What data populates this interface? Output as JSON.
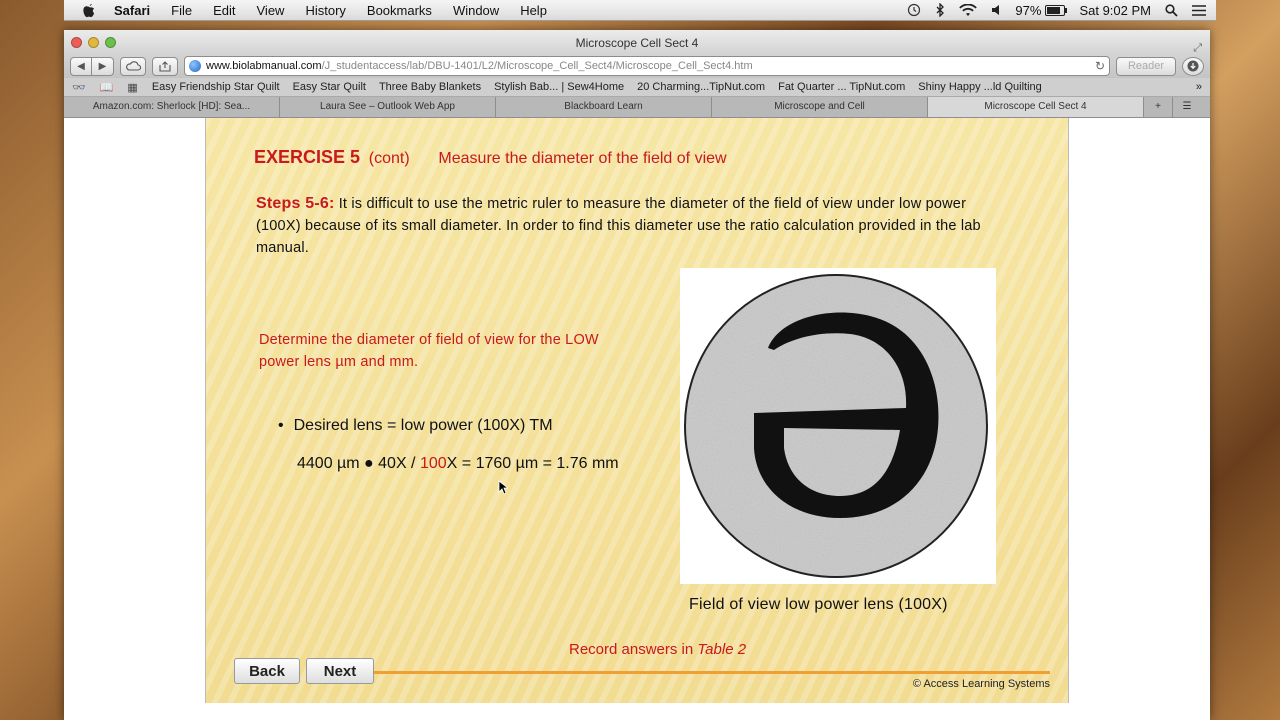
{
  "menubar": {
    "app_name": "Safari",
    "items": [
      "File",
      "Edit",
      "View",
      "History",
      "Bookmarks",
      "Window",
      "Help"
    ],
    "battery": "97%",
    "clock": "Sat 9:02 PM"
  },
  "window": {
    "title": "Microscope Cell Sect 4",
    "url_host": "www.biolabmanual.com",
    "url_path": "/J_studentaccess/lab/DBU-1401/L2/Microscope_Cell_Sect4/Microscope_Cell_Sect4.htm",
    "reader_label": "Reader"
  },
  "bookmarks": [
    "Easy Friendship Star Quilt",
    "Easy Star Quilt",
    "Three Baby Blankets",
    "Stylish Bab... | Sew4Home",
    "20 Charming...TipNut.com",
    "Fat Quarter ... TipNut.com",
    "Shiny Happy ...ld Quilting"
  ],
  "tabs": [
    {
      "label": "Amazon.com: Sherlock [HD]: Sea..."
    },
    {
      "label": "Laura See – Outlook Web App"
    },
    {
      "label": "Blackboard Learn"
    },
    {
      "label": "Microscope and Cell"
    },
    {
      "label": "Microscope Cell Sect 4",
      "active": true
    }
  ],
  "slide": {
    "exercise_title": "EXERCISE 5",
    "exercise_cont": "(cont)",
    "exercise_subtitle": "Measure the diameter of the field of view",
    "steps_label": "Steps 5-6:",
    "steps_text": " It is difficult to use the metric ruler to measure the diameter of the field of view under low power (100X) because of its small diameter. In order to find this diameter use the ratio calculation provided in the lab manual.",
    "determine_text": "Determine the diameter of field of view for the LOW power lens µm and mm.",
    "bullet_text": "Desired lens = low power (100X) TM",
    "calc_part1": "4400 µm ● 40X / ",
    "calc_highlight": "100",
    "calc_part2": "X = 1760 µm = 1.76 mm",
    "figure_caption": "Field of view low power lens (100X)",
    "record_prefix": "Record answers in ",
    "record_italic": "Table 2",
    "back_label": "Back",
    "next_label": "Next",
    "copyright": "© Access Learning Systems"
  },
  "colors": {
    "accent_red": "#c8191e",
    "slide_bg": "#f4e09a",
    "rule_orange": "#f0a030"
  }
}
